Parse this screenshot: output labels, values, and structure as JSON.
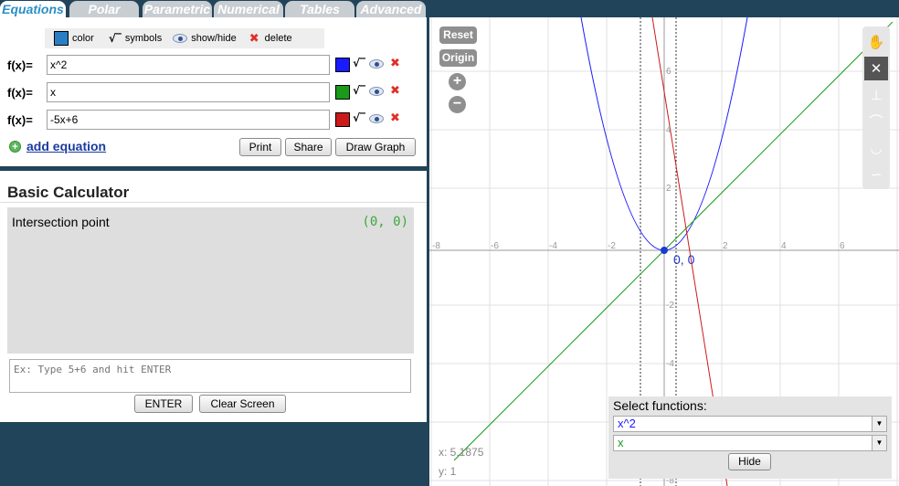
{
  "tabs": [
    "Equations",
    "Polar",
    "Parametric",
    "Numerical",
    "Tables",
    "Advanced"
  ],
  "legend": {
    "color": "color",
    "symbols": "symbols",
    "showhide": "show/hide",
    "delete": "delete"
  },
  "equations": [
    {
      "label": "f(x)=",
      "value": "x^2",
      "color": "#1a1aff"
    },
    {
      "label": "f(x)=",
      "value": "x",
      "color": "#1a9a1a"
    },
    {
      "label": "f(x)=",
      "value": "-5x+6",
      "color": "#cc1a1a"
    }
  ],
  "add_equation": "add equation",
  "buttons": {
    "print": "Print",
    "share": "Share",
    "draw": "Draw Graph"
  },
  "calculator": {
    "title": "Basic Calculator",
    "query": "Intersection point",
    "answer": "(0, 0)",
    "placeholder": "Ex: Type 5+6 and hit ENTER",
    "enter": "ENTER",
    "clear": "Clear Screen"
  },
  "graph": {
    "reset": "Reset",
    "origin": "Origin",
    "zoom_in": "+",
    "zoom_out": "−",
    "point_label": "0, 0",
    "x_ticks": [
      "-8",
      "-6",
      "-4",
      "-2",
      "2",
      "4",
      "6"
    ],
    "y_ticks": [
      "6",
      "4",
      "2",
      "-2",
      "-4",
      "-8"
    ],
    "coord_x": "x: 5.1875",
    "coord_y": "y: 1"
  },
  "select_functions": {
    "title": "Select functions:",
    "options": [
      "x^2",
      "x"
    ],
    "hide": "Hide"
  },
  "colors": {
    "tab_active": "#2a8fc4",
    "background": "#21445a",
    "parabola": "#1a1aff",
    "line_x": "#1a9a1a",
    "line_red": "#cc1a1a"
  }
}
